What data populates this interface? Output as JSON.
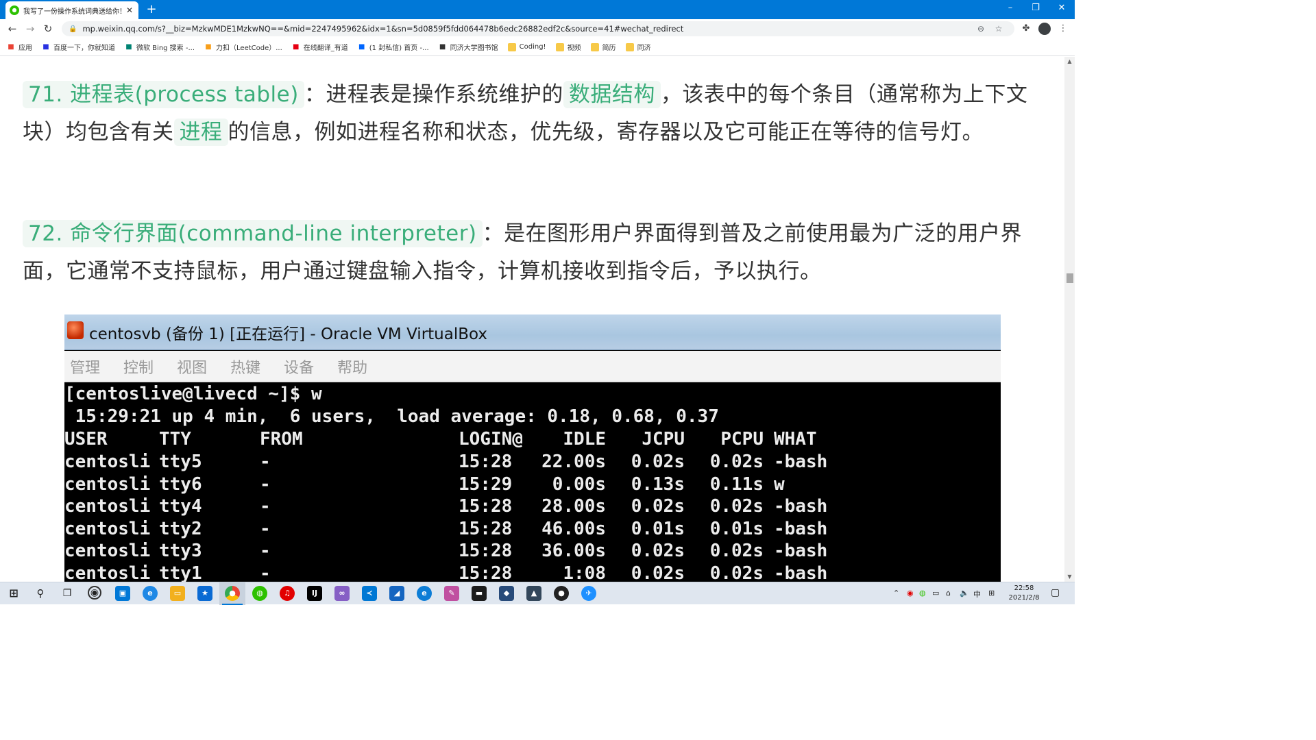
{
  "browser": {
    "tab_title": "我写了一份操作系统词典送给你！",
    "tab_close": "✕",
    "new_tab": "+",
    "window_buttons": [
      "–",
      "❐",
      "✕"
    ],
    "url": "mp.weixin.qq.com/s?__biz=MzkwMDE1MzkwNQ==&mid=2247495962&idx=1&sn=5d0859f5fdd064478b6edc26882edf2c&source=41#wechat_redirect",
    "bookmarks": [
      {
        "label": "应用",
        "icon": "apps-grid-icon",
        "color": "#ea4335"
      },
      {
        "label": "百度一下，你就知道",
        "icon": "baidu-icon",
        "color": "#2932e1"
      },
      {
        "label": "微软 Bing 搜索 -...",
        "icon": "bing-icon",
        "color": "#008373"
      },
      {
        "label": "力扣（LeetCode）...",
        "icon": "leetcode-icon",
        "color": "#f89f1b"
      },
      {
        "label": "在线翻译_有道",
        "icon": "youdao-icon",
        "color": "#e60012"
      },
      {
        "label": "(1 封私信) 首页 -...",
        "icon": "zhihu-icon",
        "color": "#0066ff"
      },
      {
        "label": "同济大学图书馆",
        "icon": "library-icon",
        "color": "#333333"
      },
      {
        "label": "Coding!",
        "icon": "folder-icon",
        "color": "#f7c948"
      },
      {
        "label": "视频",
        "icon": "folder-icon",
        "color": "#f7c948"
      },
      {
        "label": "简历",
        "icon": "folder-icon",
        "color": "#f7c948"
      },
      {
        "label": "同济",
        "icon": "folder-icon",
        "color": "#f7c948"
      }
    ]
  },
  "article": {
    "p71": {
      "term": "71. 进程表(process table)",
      "s1": "：进程表是操作系统维护的",
      "kw1": "数据结构",
      "s2": "，该表中的每个条目（通常称为上下文块）均包含有关",
      "kw2": "进程",
      "s3": "的信息，例如进程名称和状态，优先级，寄存器以及它可能正在等待的信号灯。"
    },
    "p72": {
      "term": "72. 命令行界面(command-line interpreter)",
      "s1": "：是在图形用户界面得到普及之前使用最为广泛的用户界面，它通常不支持鼠标，用户通过键盘输入指令，计算机接收到指令后，予以执行。"
    }
  },
  "vbox": {
    "title": "centosvb (备份 1) [正在运行] - Oracle VM VirtualBox",
    "menu": [
      "管理",
      "控制",
      "视图",
      "热键",
      "设备",
      "帮助"
    ],
    "prompt": "[centoslive@livecd ~]$ w",
    "uptime": " 15:29:21 up 4 min,  6 users,  load average: 0.18, 0.68, 0.37",
    "headers": [
      "USER",
      "TTY",
      "FROM",
      "LOGIN@",
      "IDLE",
      "JCPU",
      "PCPU",
      "WHAT"
    ],
    "rows": [
      [
        "centosli",
        "tty5",
        "-",
        "15:28",
        "22.00s",
        "0.02s",
        "0.02s",
        "-bash"
      ],
      [
        "centosli",
        "tty6",
        "-",
        "15:29",
        "0.00s",
        "0.13s",
        "0.11s",
        "w"
      ],
      [
        "centosli",
        "tty4",
        "-",
        "15:28",
        "28.00s",
        "0.02s",
        "0.02s",
        "-bash"
      ],
      [
        "centosli",
        "tty2",
        "-",
        "15:28",
        "46.00s",
        "0.01s",
        "0.01s",
        "-bash"
      ],
      [
        "centosli",
        "tty3",
        "-",
        "15:28",
        "36.00s",
        "0.02s",
        "0.02s",
        "-bash"
      ],
      [
        "centosli",
        "tty1",
        "-",
        "15:28",
        "1:08",
        "0.02s",
        "0.02s",
        "-bash"
      ]
    ]
  },
  "taskbar": {
    "time": "22:58",
    "date": "2021/2/8",
    "ime": "中",
    "apps": [
      {
        "name": "file-explorer-icon",
        "color": "#f2b01e"
      },
      {
        "name": "chrome-icon",
        "color": "#ea4335"
      },
      {
        "name": "wechat-icon",
        "color": "#2dc100"
      },
      {
        "name": "netease-music-icon",
        "color": "#e20000"
      },
      {
        "name": "jetbrains-icon",
        "color": "#000000"
      },
      {
        "name": "visual-studio-icon",
        "color": "#865fc5"
      },
      {
        "name": "vscode-icon",
        "color": "#0078d4"
      },
      {
        "name": "edge-icon",
        "color": "#0c7dd6"
      }
    ]
  }
}
